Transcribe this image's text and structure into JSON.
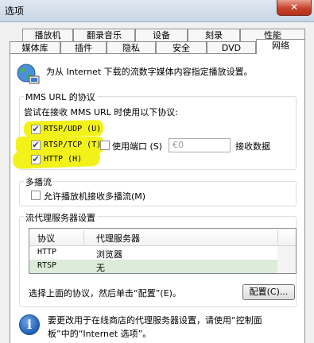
{
  "window": {
    "title": "选项",
    "close_label": "✕"
  },
  "tabs_row1": [
    "播放机",
    "翻录音乐",
    "设备",
    "刻录",
    "性能"
  ],
  "tabs_row2": [
    "媒体库",
    "插件",
    "隐私",
    "安全",
    "DVD",
    "网络"
  ],
  "active_tab": "网络",
  "description": "为从 Internet 下载的流数字媒体内容指定播放设置。",
  "mms": {
    "group_title": "MMS URL 的协议",
    "instruction": "尝试在接收 MMS URL 时使用以下协议:",
    "protocols": [
      {
        "label": "RTSP/UDP (U)",
        "checked": true,
        "check_mark": "✔"
      },
      {
        "label": "RTSP/TCP (T)",
        "checked": true,
        "check_mark": "✔"
      },
      {
        "label": "HTTP (H)",
        "checked": true,
        "check_mark": "✔"
      }
    ],
    "use_port_label": "使用端口 (S)",
    "use_port_checked": false,
    "port_value": "€0",
    "receive_data_label": "接收数据"
  },
  "multicast": {
    "group_title": "多播流",
    "allow_label": "允许播放机接收多播流(M)",
    "checked": false
  },
  "proxy": {
    "group_title": "流代理服务器设置",
    "columns": [
      "协议",
      "代理服务器"
    ],
    "rows": [
      {
        "protocol": "HTTP",
        "server": "浏览器",
        "selected": false
      },
      {
        "protocol": "RTSP",
        "server": "无",
        "selected": true
      }
    ],
    "hint": "选择上面的协议，然后单击“配置”(E)。",
    "configure_button": "配置(C)..."
  },
  "footer": {
    "line1": "要更改用于在线商店的代理服务器设置，请使用“控制面",
    "line2": "板”中的“Internet 选项”。"
  },
  "colors": {
    "highlight": "#f2f21a",
    "selected_row": "#dcecd8",
    "close_button": "#c7422b"
  }
}
